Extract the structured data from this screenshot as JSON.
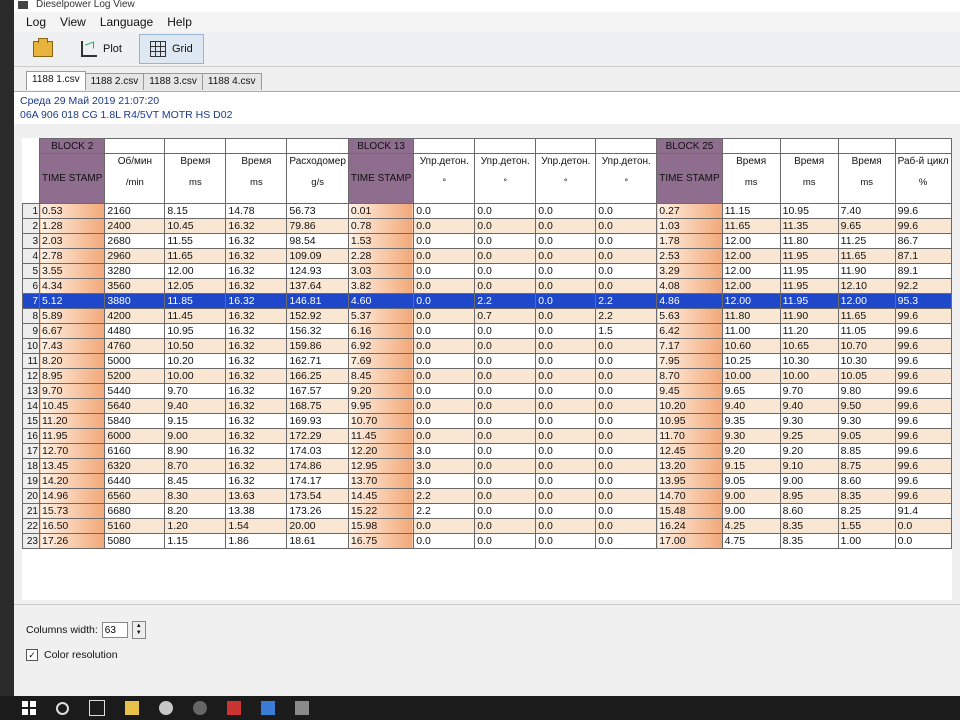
{
  "window": {
    "title": "Dieselpower Log View"
  },
  "menu": [
    "Log",
    "View",
    "Language",
    "Help"
  ],
  "toolbar": {
    "plot_label": "Plot",
    "grid_label": "Grid"
  },
  "file_tabs": [
    "1188 1.csv",
    "1188 2.csv",
    "1188 3.csv",
    "1188 4.csv"
  ],
  "info": {
    "line1": "Среда 29 Май 2019 21:07:20",
    "line2": "06A 906 018 CG  1.8L R4/5VT MOTR HS D02"
  },
  "grid": {
    "block_labels": [
      "BLOCK 2",
      "BLOCK 13",
      "BLOCK 25"
    ],
    "timestamp_label": "TIME STAMP",
    "headers": [
      {
        "name": "Об/мин",
        "unit": "/min"
      },
      {
        "name": "Время",
        "unit": "ms"
      },
      {
        "name": "Время",
        "unit": "ms"
      },
      {
        "name": "Расходомер",
        "unit": "g/s"
      },
      {
        "name": "Упр.детон.",
        "unit": "°"
      },
      {
        "name": "Упр.детон.",
        "unit": "°"
      },
      {
        "name": "Упр.детон.",
        "unit": "°"
      },
      {
        "name": "Упр.детон.",
        "unit": "°"
      },
      {
        "name": "Время",
        "unit": "ms"
      },
      {
        "name": "Время",
        "unit": "ms"
      },
      {
        "name": "Время",
        "unit": "ms"
      },
      {
        "name": "Раб-й цикл",
        "unit": "%"
      }
    ],
    "selected_row": 7,
    "rows": [
      [
        "1",
        "0.53",
        "2160",
        "8.15",
        "14.78",
        "56.73",
        "0.01",
        "0.0",
        "0.0",
        "0.0",
        "0.0",
        "0.27",
        "11.15",
        "10.95",
        "7.40",
        "99.6"
      ],
      [
        "2",
        "1.28",
        "2400",
        "10.45",
        "16.32",
        "79.86",
        "0.78",
        "0.0",
        "0.0",
        "0.0",
        "0.0",
        "1.03",
        "11.65",
        "11.35",
        "9.65",
        "99.6"
      ],
      [
        "3",
        "2.03",
        "2680",
        "11.55",
        "16.32",
        "98.54",
        "1.53",
        "0.0",
        "0.0",
        "0.0",
        "0.0",
        "1.78",
        "12.00",
        "11.80",
        "11.25",
        "86.7"
      ],
      [
        "4",
        "2.78",
        "2960",
        "11.65",
        "16.32",
        "109.09",
        "2.28",
        "0.0",
        "0.0",
        "0.0",
        "0.0",
        "2.53",
        "12.00",
        "11.95",
        "11.65",
        "87.1"
      ],
      [
        "5",
        "3.55",
        "3280",
        "12.00",
        "16.32",
        "124.93",
        "3.03",
        "0.0",
        "0.0",
        "0.0",
        "0.0",
        "3.29",
        "12.00",
        "11.95",
        "11.90",
        "89.1"
      ],
      [
        "6",
        "4.34",
        "3560",
        "12.05",
        "16.32",
        "137.64",
        "3.82",
        "0.0",
        "0.0",
        "0.0",
        "0.0",
        "4.08",
        "12.00",
        "11.95",
        "12.10",
        "92.2"
      ],
      [
        "7",
        "5.12",
        "3880",
        "11.85",
        "16.32",
        "146.81",
        "4.60",
        "0.0",
        "2.2",
        "0.0",
        "2.2",
        "4.86",
        "12.00",
        "11.95",
        "12.00",
        "95.3"
      ],
      [
        "8",
        "5.89",
        "4200",
        "11.45",
        "16.32",
        "152.92",
        "5.37",
        "0.0",
        "0.7",
        "0.0",
        "2.2",
        "5.63",
        "11.80",
        "11.90",
        "11.65",
        "99.6"
      ],
      [
        "9",
        "6.67",
        "4480",
        "10.95",
        "16.32",
        "156.32",
        "6.16",
        "0.0",
        "0.0",
        "0.0",
        "1.5",
        "6.42",
        "11.00",
        "11.20",
        "11.05",
        "99.6"
      ],
      [
        "10",
        "7.43",
        "4760",
        "10.50",
        "16.32",
        "159.86",
        "6.92",
        "0.0",
        "0.0",
        "0.0",
        "0.0",
        "7.17",
        "10.60",
        "10.65",
        "10.70",
        "99.6"
      ],
      [
        "11",
        "8.20",
        "5000",
        "10.20",
        "16.32",
        "162.71",
        "7.69",
        "0.0",
        "0.0",
        "0.0",
        "0.0",
        "7.95",
        "10.25",
        "10.30",
        "10.30",
        "99.6"
      ],
      [
        "12",
        "8.95",
        "5200",
        "10.00",
        "16.32",
        "166.25",
        "8.45",
        "0.0",
        "0.0",
        "0.0",
        "0.0",
        "8.70",
        "10.00",
        "10.00",
        "10.05",
        "99.6"
      ],
      [
        "13",
        "9.70",
        "5440",
        "9.70",
        "16.32",
        "167.57",
        "9.20",
        "0.0",
        "0.0",
        "0.0",
        "0.0",
        "9.45",
        "9.65",
        "9.70",
        "9.80",
        "99.6"
      ],
      [
        "14",
        "10.45",
        "5640",
        "9.40",
        "16.32",
        "168.75",
        "9.95",
        "0.0",
        "0.0",
        "0.0",
        "0.0",
        "10.20",
        "9.40",
        "9.40",
        "9.50",
        "99.6"
      ],
      [
        "15",
        "11.20",
        "5840",
        "9.15",
        "16.32",
        "169.93",
        "10.70",
        "0.0",
        "0.0",
        "0.0",
        "0.0",
        "10.95",
        "9.35",
        "9.30",
        "9.30",
        "99.6"
      ],
      [
        "16",
        "11.95",
        "6000",
        "9.00",
        "16.32",
        "172.29",
        "11.45",
        "0.0",
        "0.0",
        "0.0",
        "0.0",
        "11.70",
        "9.30",
        "9.25",
        "9.05",
        "99.6"
      ],
      [
        "17",
        "12.70",
        "6160",
        "8.90",
        "16.32",
        "174.03",
        "12.20",
        "3.0",
        "0.0",
        "0.0",
        "0.0",
        "12.45",
        "9.20",
        "9.20",
        "8.85",
        "99.6"
      ],
      [
        "18",
        "13.45",
        "6320",
        "8.70",
        "16.32",
        "174.86",
        "12.95",
        "3.0",
        "0.0",
        "0.0",
        "0.0",
        "13.20",
        "9.15",
        "9.10",
        "8.75",
        "99.6"
      ],
      [
        "19",
        "14.20",
        "6440",
        "8.45",
        "16.32",
        "174.17",
        "13.70",
        "3.0",
        "0.0",
        "0.0",
        "0.0",
        "13.95",
        "9.05",
        "9.00",
        "8.60",
        "99.6"
      ],
      [
        "20",
        "14.96",
        "6560",
        "8.30",
        "13.63",
        "173.54",
        "14.45",
        "2.2",
        "0.0",
        "0.0",
        "0.0",
        "14.70",
        "9.00",
        "8.95",
        "8.35",
        "99.6"
      ],
      [
        "21",
        "15.73",
        "6680",
        "8.20",
        "13.38",
        "173.26",
        "15.22",
        "2.2",
        "0.0",
        "0.0",
        "0.0",
        "15.48",
        "9.00",
        "8.60",
        "8.25",
        "91.4"
      ],
      [
        "22",
        "16.50",
        "5160",
        "1.20",
        "1.54",
        "20.00",
        "15.98",
        "0.0",
        "0.0",
        "0.0",
        "0.0",
        "16.24",
        "4.25",
        "8.35",
        "1.55",
        "0.0"
      ],
      [
        "23",
        "17.26",
        "5080",
        "1.15",
        "1.86",
        "18.61",
        "16.75",
        "0.0",
        "0.0",
        "0.0",
        "0.0",
        "17.00",
        "4.75",
        "8.35",
        "1.00",
        "0.0"
      ]
    ]
  },
  "bottom": {
    "columns_width_label": "Columns width:",
    "columns_width_value": "63",
    "color_resolution_label": "Color resolution"
  }
}
